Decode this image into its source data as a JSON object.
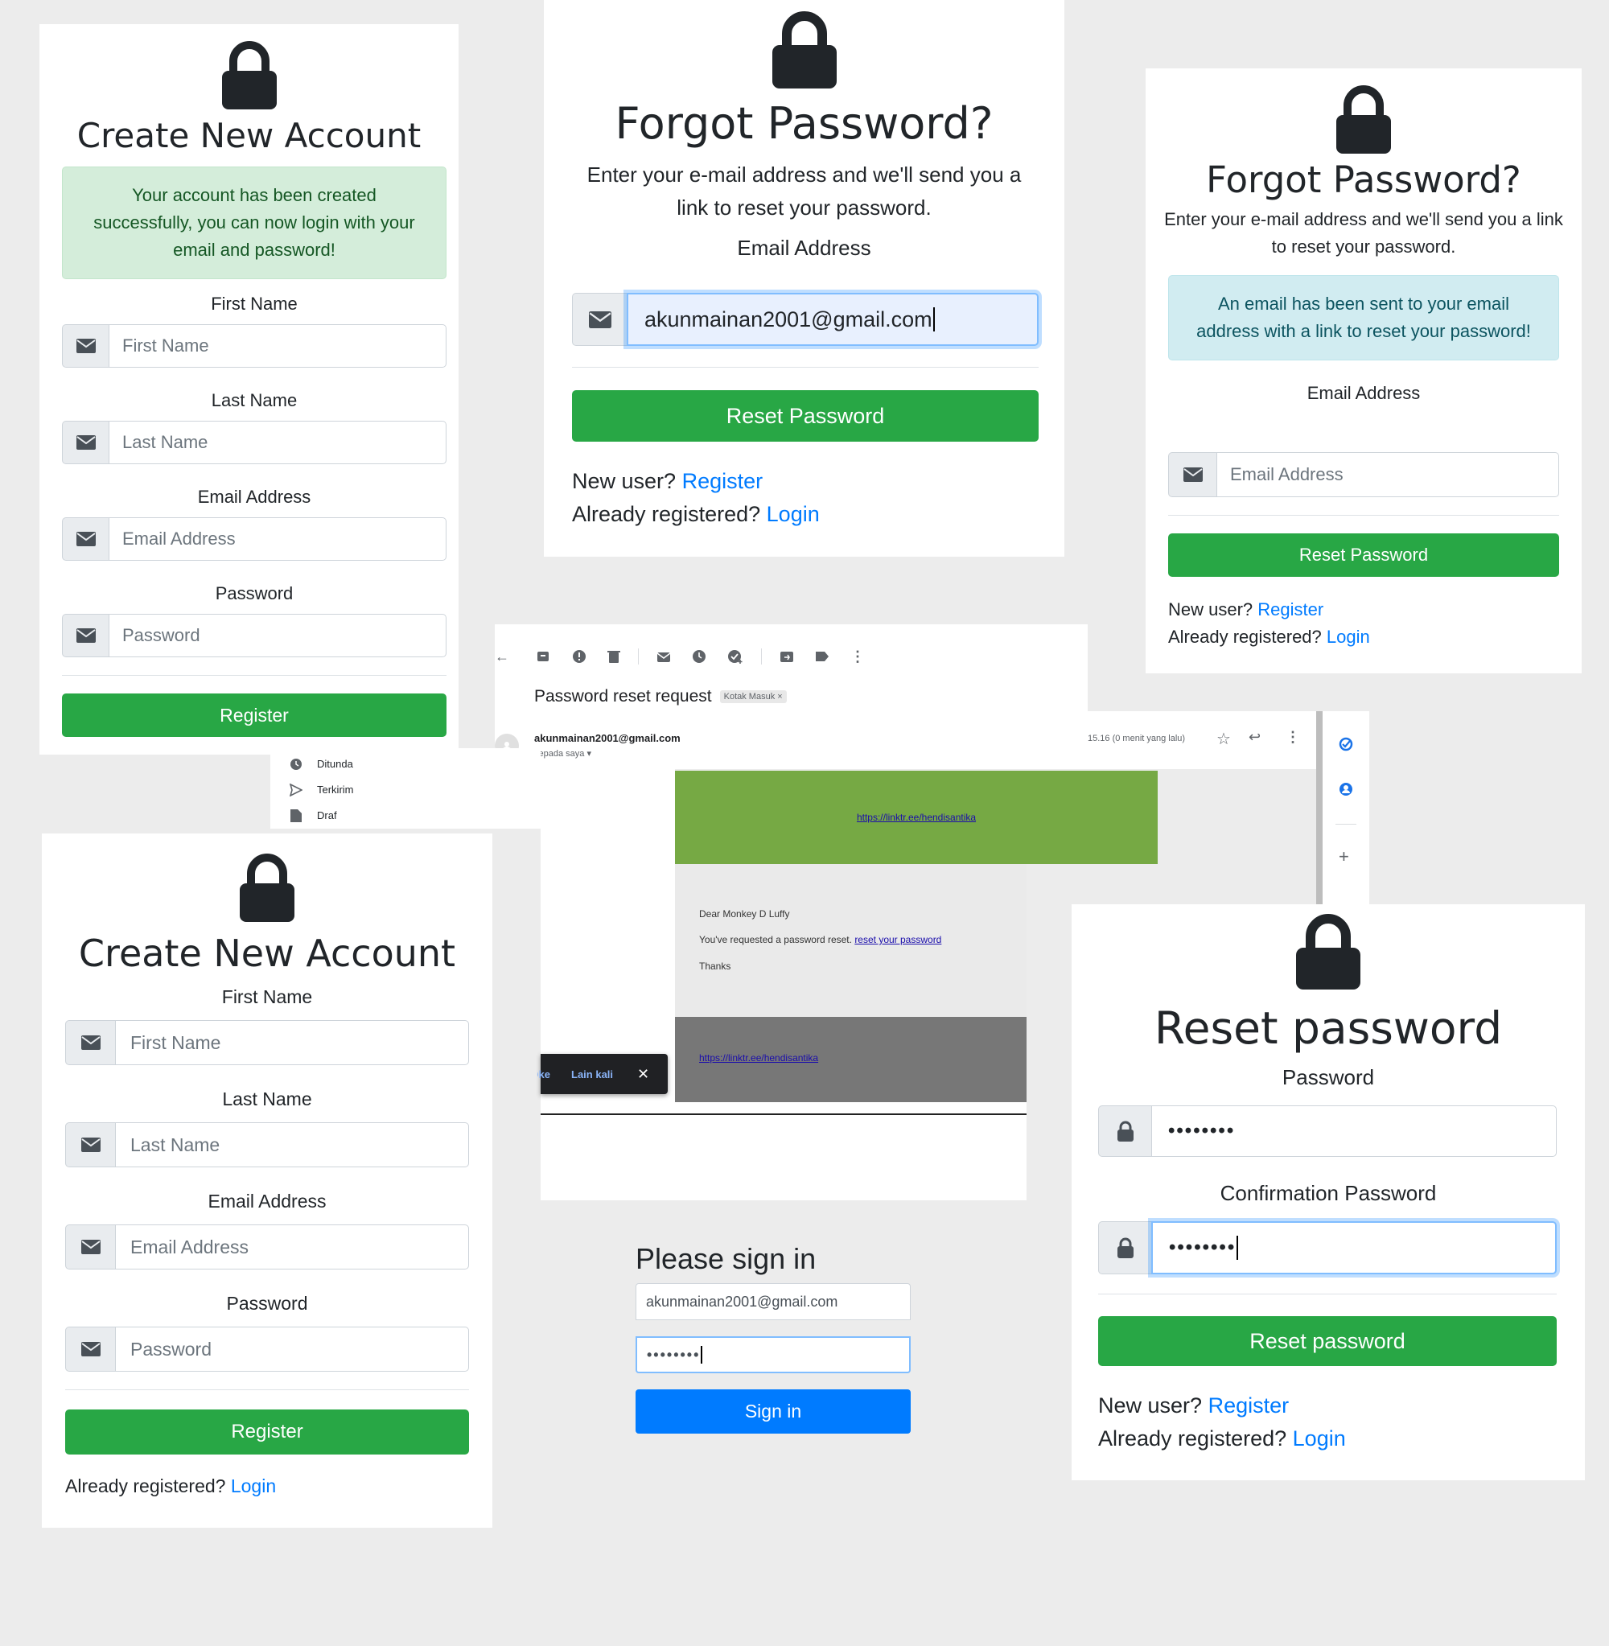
{
  "panel1": {
    "title": "Create New Account",
    "alert": "Your account has been created successfully, you can now login with your email and password!",
    "fields": [
      {
        "label": "First Name",
        "placeholder": "First Name"
      },
      {
        "label": "Last Name",
        "placeholder": "Last Name"
      },
      {
        "label": "Email Address",
        "placeholder": "Email Address"
      },
      {
        "label": "Password",
        "placeholder": "Password"
      }
    ],
    "button": "Register"
  },
  "panel2": {
    "title": "Forgot Password?",
    "subtitle": "Enter your e-mail address and we'll send you a link to reset your password.",
    "field_label": "Email Address",
    "field_value": "akunmainan2001@gmail.com",
    "button": "Reset Password",
    "new_user_text": "New user?",
    "register_link": "Register",
    "already_text": "Already registered?",
    "login_link": "Login"
  },
  "panel3": {
    "title": "Forgot Password?",
    "subtitle": "Enter your e-mail address and we'll send you a link to reset your password.",
    "alert": "An email has been sent to your email address with a link to reset your password!",
    "field_label": "Email Address",
    "field_placeholder": "Email Address",
    "button": "Reset Password",
    "new_user_text": "New user?",
    "register_link": "Register",
    "already_text": "Already registered?",
    "login_link": "Login"
  },
  "gmail": {
    "subject": "Password reset request",
    "label_badge": "Kotak Masuk ×",
    "sender": "akunmainan2001@gmail.com",
    "to": "kepada saya",
    "time": "15.16 (0 menit yang lalu)",
    "banner_link": "https://linktr.ee/hendisantika",
    "greeting": "Dear Monkey D Luffy",
    "body_text": "You've requested a password reset.",
    "body_link": "reset your password",
    "thanks": "Thanks",
    "footer_link": "https://linktr.ee/hendisantika",
    "sidebar_items": [
      "Ditunda",
      "Terkirim",
      "Draf"
    ],
    "snackbar_ok": "Oke",
    "snackbar_later": "Lain kali",
    "colors": {
      "banner": "#76a944",
      "footer": "#777777",
      "body_bg": "#eaeaea"
    }
  },
  "panel4": {
    "title": "Create New Account",
    "fields": [
      {
        "label": "First Name",
        "placeholder": "First Name"
      },
      {
        "label": "Last Name",
        "placeholder": "Last Name"
      },
      {
        "label": "Email Address",
        "placeholder": "Email Address"
      },
      {
        "label": "Password",
        "placeholder": "Password"
      }
    ],
    "button": "Register",
    "already_text": "Already registered?",
    "login_link": "Login"
  },
  "signin": {
    "title": "Please sign in",
    "email_value": "akunmainan2001@gmail.com",
    "password_value": "••••••••",
    "button": "Sign in"
  },
  "panel5": {
    "title": "Reset password",
    "password_label": "Password",
    "password_value": "••••••••",
    "confirm_label": "Confirmation Password",
    "confirm_value": "••••••••",
    "button": "Reset password",
    "new_user_text": "New user?",
    "register_link": "Register",
    "already_text": "Already registered?",
    "login_link": "Login"
  },
  "colors": {
    "green": "#28a745",
    "blue": "#007bff",
    "link": "#007bff"
  }
}
